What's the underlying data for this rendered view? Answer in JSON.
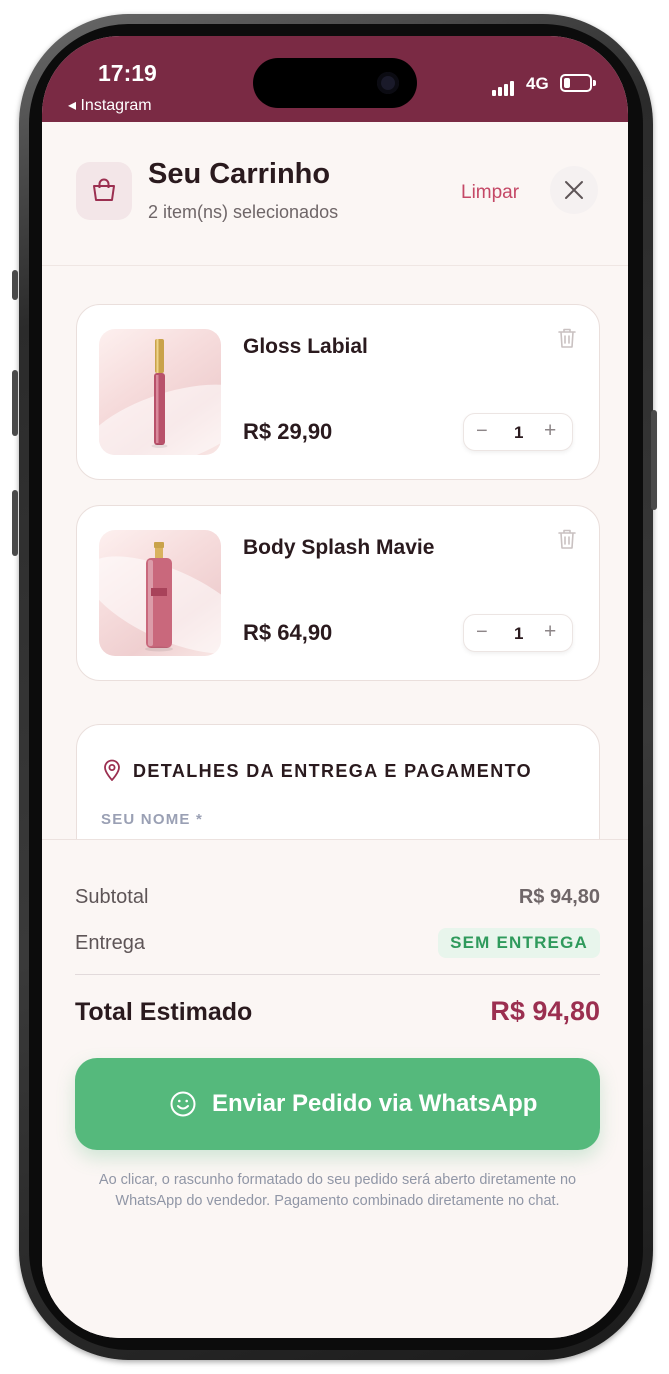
{
  "status_bar": {
    "time": "17:19",
    "back_app": "◂ Instagram",
    "network": "4G",
    "battery_level": 0.25
  },
  "header": {
    "title": "Seu Carrinho",
    "subtitle": "2 item(ns) selecionados",
    "clear_label": "Limpar",
    "bag_icon": "shopping-bag-icon",
    "close_icon": "close-icon"
  },
  "cart": {
    "items": [
      {
        "name": "Gloss Labial",
        "price": "R$ 29,90",
        "quantity": "1",
        "minus": "−",
        "plus": "+"
      },
      {
        "name": "Body Splash Mavie",
        "price": "R$ 64,90",
        "quantity": "1",
        "minus": "−",
        "plus": "+"
      }
    ]
  },
  "delivery": {
    "title": "DETALHES DA ENTREGA E PAGAMENTO",
    "name_label": "SEU NOME *",
    "icon": "location-pin-icon"
  },
  "summary": {
    "subtotal_label": "Subtotal",
    "subtotal_value": "R$ 94,80",
    "delivery_label": "Entrega",
    "delivery_value": "SEM ENTREGA",
    "total_label": "Total Estimado",
    "total_value": "R$ 94,80"
  },
  "cta": {
    "label": "Enviar Pedido via WhatsApp",
    "icon": "smile-icon",
    "note": "Ao clicar, o rascunho formatado do seu pedido será aberto diretamente no WhatsApp do vendedor. Pagamento combinado diretamente no chat."
  },
  "colors": {
    "brand": "#7a2a44",
    "accent": "#c44866",
    "total": "#9b2f50",
    "whatsapp_green": "#55b97c"
  }
}
